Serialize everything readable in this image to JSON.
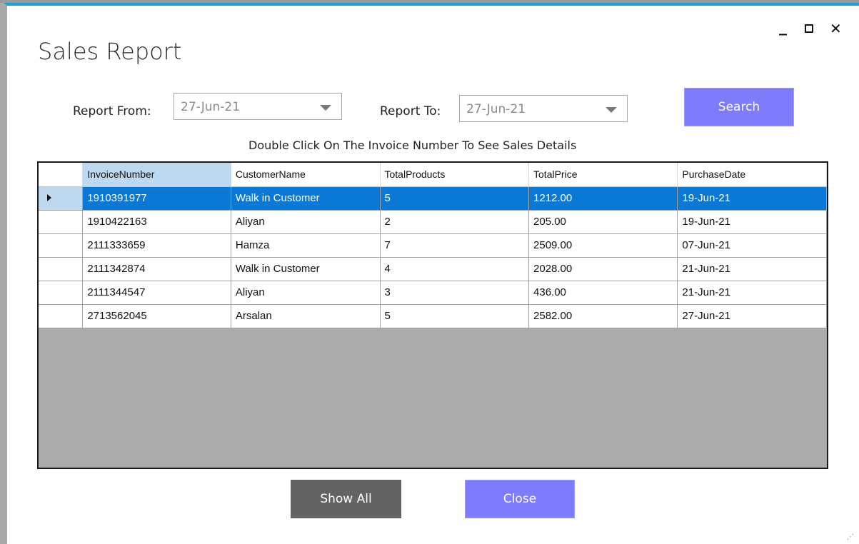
{
  "window": {
    "title": "Sales Report",
    "controls": {
      "minimize": "_",
      "close": "✕"
    }
  },
  "filters": {
    "from_label": "Report From:",
    "from_value": "27-Jun-21",
    "to_label": "Report To:",
    "to_value": "27-Jun-21",
    "search_label": "Search"
  },
  "hint": "Double Click On The Invoice Number To See Sales Details",
  "grid": {
    "columns": [
      "InvoiceNumber",
      "CustomerName",
      "TotalProducts",
      "TotalPrice",
      "PurchaseDate"
    ],
    "rows": [
      [
        "1910391977",
        "Walk in Customer",
        "5",
        "1212.00",
        "19-Jun-21"
      ],
      [
        "1910422163",
        "Aliyan",
        "2",
        "205.00",
        "19-Jun-21"
      ],
      [
        "2111333659",
        "Hamza",
        "7",
        "2509.00",
        "07-Jun-21"
      ],
      [
        "2111342874",
        "Walk in Customer",
        "4",
        "2028.00",
        "21-Jun-21"
      ],
      [
        "2111344547",
        "Aliyan",
        "3",
        "436.00",
        "21-Jun-21"
      ],
      [
        "2713562045",
        "Arsalan",
        "5",
        "2582.00",
        "27-Jun-21"
      ]
    ]
  },
  "actions": {
    "show_all_label": "Show All",
    "close_label": "Close"
  },
  "colors": {
    "accent": "#7f7cfb",
    "selection": "#0a78d7",
    "title_bar": "#1fa0d8",
    "dark_button": "#636363"
  }
}
